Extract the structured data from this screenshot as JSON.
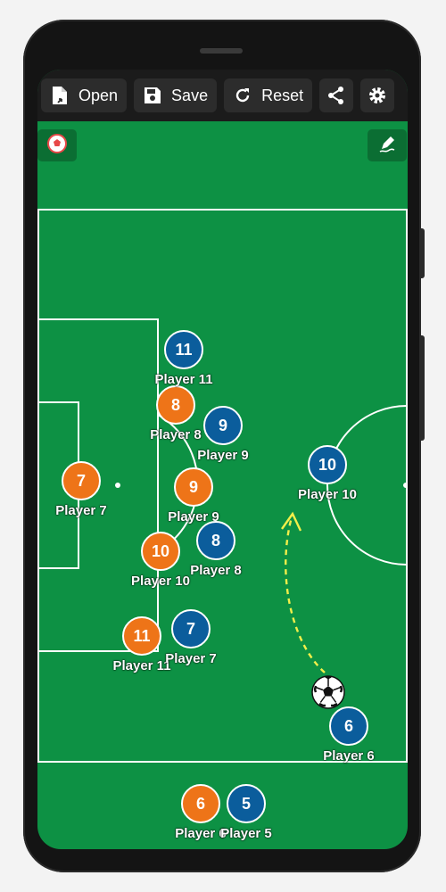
{
  "toolbar": {
    "open_label": "Open",
    "save_label": "Save",
    "reset_label": "Reset",
    "share_icon": "share-icon",
    "settings_icon": "gear-icon"
  },
  "corner_buttons": {
    "left_icon": "soccer-ball-icon",
    "right_icon": "draw-pen-icon"
  },
  "colors": {
    "pitch": "#0d9144",
    "orange_team": "#ee7418",
    "blue_team": "#0b5d9c",
    "arrow": "#f2ef4a"
  },
  "orange_players": [
    {
      "number": "7",
      "label": "Player 7"
    },
    {
      "number": "8",
      "label": "Player 8"
    },
    {
      "number": "9",
      "label": "Player 9"
    },
    {
      "number": "10",
      "label": "Player 10"
    },
    {
      "number": "11",
      "label": "Player 11"
    },
    {
      "number": "6",
      "label": "Player 6"
    }
  ],
  "blue_players": [
    {
      "number": "11",
      "label": "Player 11"
    },
    {
      "number": "9",
      "label": "Player 9"
    },
    {
      "number": "10",
      "label": "Player 10"
    },
    {
      "number": "8",
      "label": "Player 8"
    },
    {
      "number": "7",
      "label": "Player 7"
    },
    {
      "number": "6",
      "label": "Player 6"
    },
    {
      "number": "5",
      "label": "Player 5"
    }
  ]
}
